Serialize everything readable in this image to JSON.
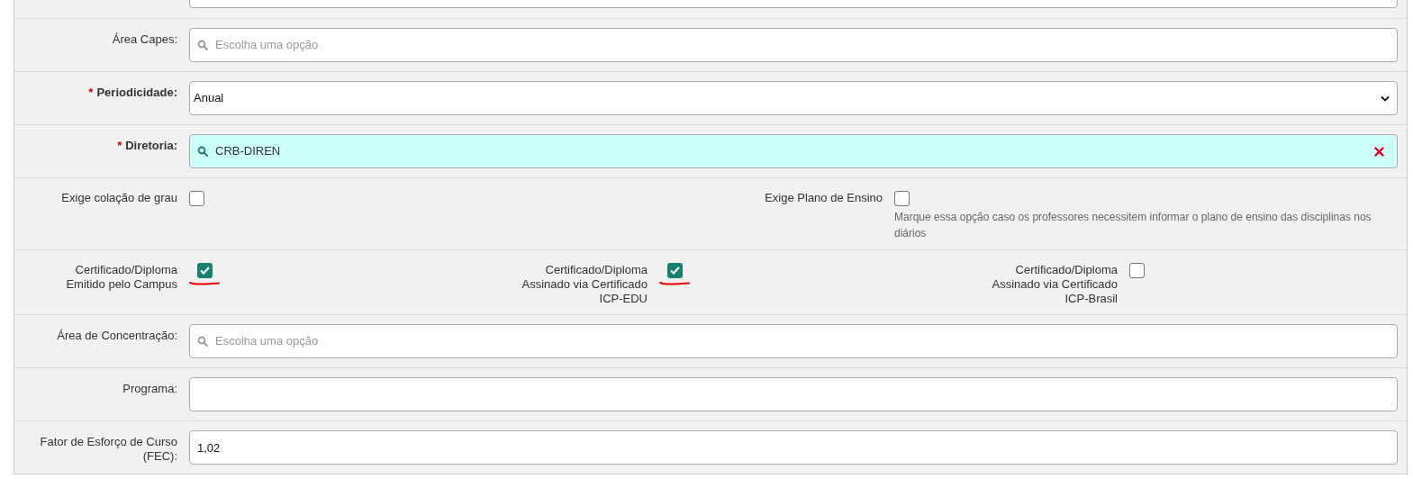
{
  "fields": [
    {
      "kind": "cut_text"
    },
    {
      "kind": "search_select",
      "label": [
        "Área Capes:"
      ],
      "placeholder": "Escolha uma opção",
      "clearable": false
    },
    {
      "kind": "select",
      "label": [
        "Periodicidade:"
      ],
      "required_mark": "*",
      "value": "Anual"
    },
    {
      "kind": "search_select",
      "label": [
        "Diretoria:"
      ],
      "required_mark": "*",
      "value": "CRB-DIREN",
      "clearable": true
    },
    {
      "kind": "checkboxes",
      "items": [
        {
          "label": [
            "Exige colação de grau"
          ],
          "checked": false,
          "underlined": false
        },
        {
          "label": [
            "Exige Plano de Ensino"
          ],
          "checked": false,
          "underlined": false,
          "help": "Marque essa opção caso os professores necessitem informar o plano de ensino das disciplinas nos diários"
        }
      ]
    },
    {
      "kind": "checkboxes",
      "items": [
        {
          "label": [
            "Certificado/Diploma",
            "Emitido pelo Campus"
          ],
          "checked": true,
          "underlined": true
        },
        {
          "label": [
            "Certificado/Diploma",
            "Assinado via Certificado",
            "ICP-EDU"
          ],
          "checked": true,
          "underlined": true
        },
        {
          "label": [
            "Certificado/Diploma",
            "Assinado via Certificado",
            "ICP-Brasil"
          ],
          "checked": false,
          "underlined": false
        }
      ]
    },
    {
      "kind": "search_select",
      "label": [
        "Área de Concentração:"
      ],
      "placeholder": "Escolha uma opção",
      "clearable": false
    },
    {
      "kind": "text",
      "label": [
        "Programa:"
      ]
    },
    {
      "kind": "text",
      "label": [
        "Fator de Esforço de Curso",
        "(FEC):"
      ],
      "value": "1,02"
    }
  ]
}
